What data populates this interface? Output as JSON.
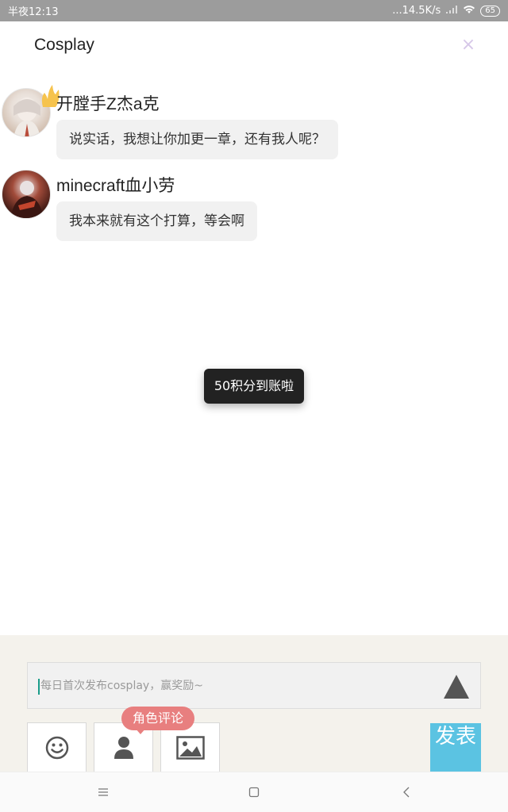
{
  "status_bar": {
    "time": "半夜12:13",
    "network_speed": "...14.5K/s",
    "battery": "65"
  },
  "header": {
    "title": "Cosplay",
    "close_label": "×"
  },
  "comments": [
    {
      "username": "开膛手Z杰a克",
      "text": "说实话，我想让你加更一章，还有我人呢？",
      "has_crown": true
    },
    {
      "username": "minecraft血小劳",
      "text": "我本来就有这个打算，等会啊",
      "has_crown": false
    }
  ],
  "toast": {
    "text": "50积分到账啦"
  },
  "composer": {
    "placeholder": "每日首次发布cosplay，赢奖励~",
    "role_tip": "角色评论",
    "publish_label": "发表"
  },
  "icons": {
    "close": "close-icon",
    "send": "send-triangle-icon",
    "emoji": "emoji-icon",
    "role": "person-icon",
    "image": "image-icon",
    "menu": "menu-icon",
    "home": "home-square-icon",
    "back": "back-chevron-icon"
  },
  "colors": {
    "publish": "#5bc3e2",
    "role_tip": "#e87f7f",
    "toast_bg": "#222222",
    "composer_bg": "#f4f2ec"
  }
}
